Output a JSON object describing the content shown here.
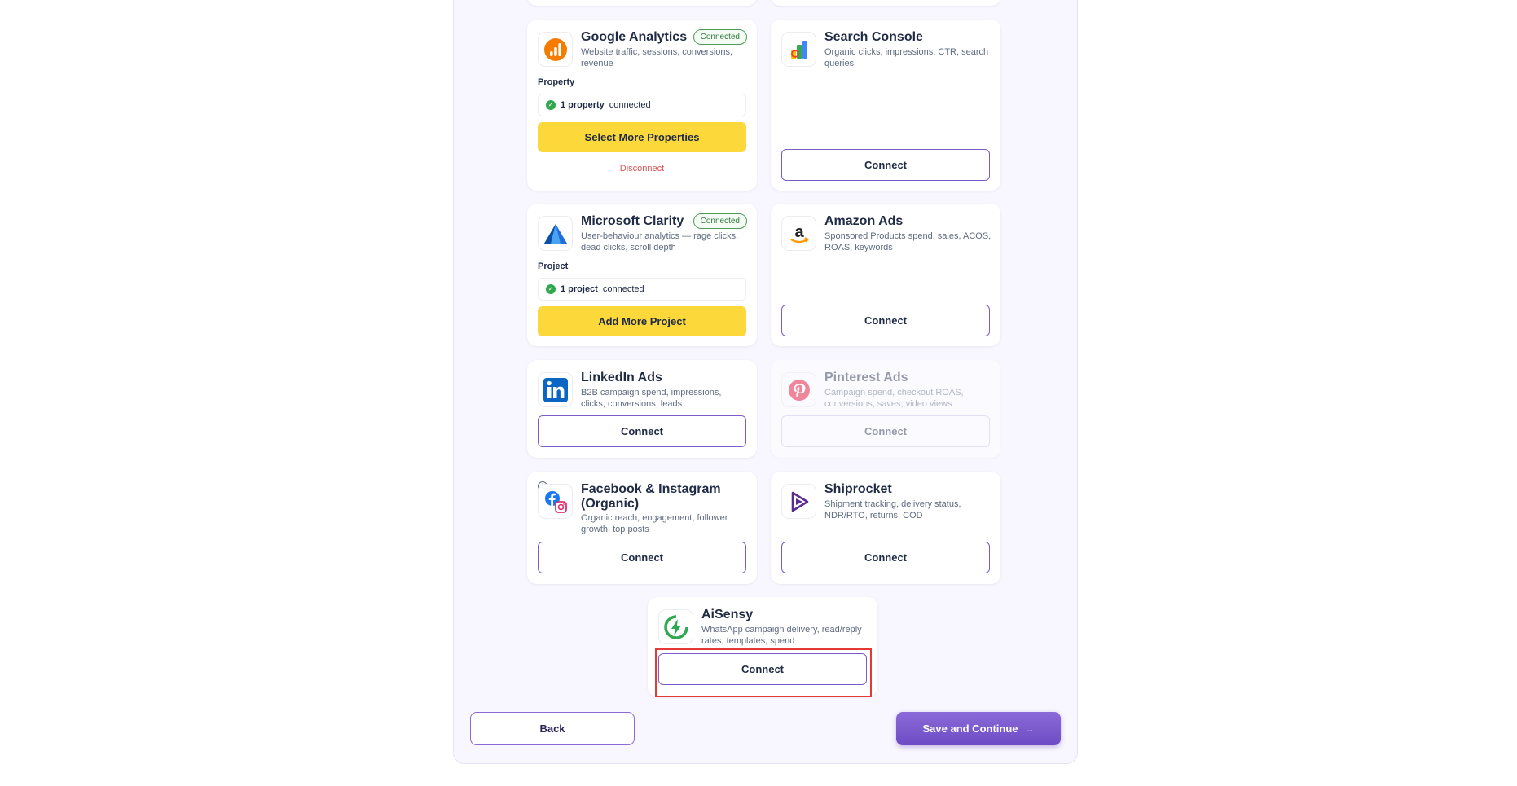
{
  "cards": {
    "google_analytics": {
      "title": "Google Analytics",
      "desc": "Website traffic, sessions, conversions, revenue",
      "badge": "Connected",
      "label": "Property",
      "status_bold": "1 property",
      "status_rest": "connected",
      "primary": "Select More Properties",
      "disconnect": "Disconnect"
    },
    "search_console": {
      "title": "Search Console",
      "desc": "Organic clicks, impressions, CTR, search queries",
      "button": "Connect"
    },
    "microsoft_clarity": {
      "title": "Microsoft Clarity",
      "desc": "User-behaviour analytics — rage clicks, dead clicks, scroll depth",
      "badge": "Connected",
      "label": "Project",
      "status_bold": "1 project",
      "status_rest": "connected",
      "primary": "Add More Project"
    },
    "amazon_ads": {
      "title": "Amazon Ads",
      "desc": "Sponsored Products spend, sales, ACOS, ROAS, keywords",
      "button": "Connect"
    },
    "linkedin_ads": {
      "title": "LinkedIn Ads",
      "desc": "B2B campaign spend, impressions, clicks, conversions, leads",
      "button": "Connect"
    },
    "pinterest_ads": {
      "title": "Pinterest Ads",
      "desc": "Campaign spend, checkout ROAS, conversions, saves, video views",
      "button": "Connect"
    },
    "facebook_instagram": {
      "title": "Facebook & Instagram (Organic)",
      "desc": "Organic reach, engagement, follower growth, top posts",
      "button": "Connect"
    },
    "shiprocket": {
      "title": "Shiprocket",
      "desc": "Shipment tracking, delivery status, NDR/RTO, returns, COD",
      "button": "Connect"
    },
    "aisensy": {
      "title": "AiSensy",
      "desc": "WhatsApp campaign delivery, read/reply rates, templates, spend",
      "button": "Connect"
    }
  },
  "footer": {
    "back": "Back",
    "save": "Save and Continue",
    "save_arrow": "→"
  },
  "colors": {
    "accent": "#7b5cc8",
    "yellow": "#fcd83a",
    "connected": "#2f7b3c",
    "disconnect": "#e05252"
  }
}
